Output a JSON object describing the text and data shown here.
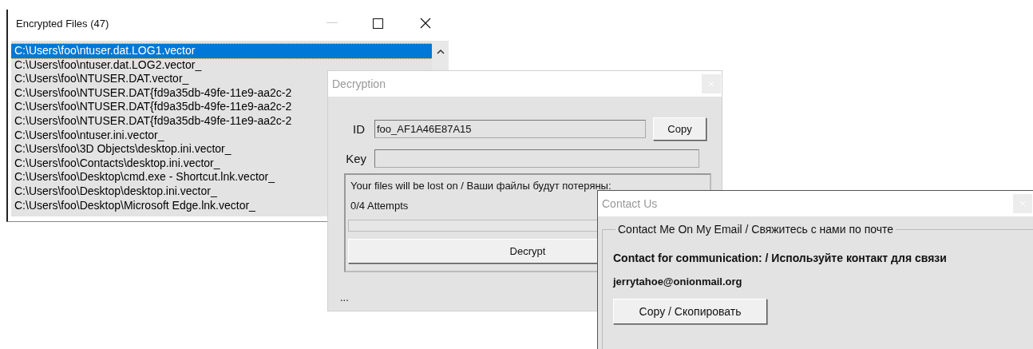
{
  "files_window": {
    "title": "Encrypted Files (47)",
    "files": [
      {
        "path": "C:\\Users\\foo\\ntuser.dat.LOG1.vector",
        "selected": true
      },
      {
        "path": "C:\\Users\\foo\\ntuser.dat.LOG2.vector_",
        "selected": false
      },
      {
        "path": "C:\\Users\\foo\\NTUSER.DAT.vector_",
        "selected": false
      },
      {
        "path": "C:\\Users\\foo\\NTUSER.DAT{fd9a35db-49fe-11e9-aa2c-2",
        "selected": false
      },
      {
        "path": "C:\\Users\\foo\\NTUSER.DAT{fd9a35db-49fe-11e9-aa2c-2",
        "selected": false
      },
      {
        "path": "C:\\Users\\foo\\NTUSER.DAT{fd9a35db-49fe-11e9-aa2c-2",
        "selected": false
      },
      {
        "path": "C:\\Users\\foo\\ntuser.ini.vector_",
        "selected": false
      },
      {
        "path": "C:\\Users\\foo\\3D Objects\\desktop.ini.vector_",
        "selected": false
      },
      {
        "path": "C:\\Users\\foo\\Contacts\\desktop.ini.vector_",
        "selected": false
      },
      {
        "path": "C:\\Users\\foo\\Desktop\\cmd.exe - Shortcut.lnk.vector_",
        "selected": false
      },
      {
        "path": "C:\\Users\\foo\\Desktop\\desktop.ini.vector_",
        "selected": false
      },
      {
        "path": "C:\\Users\\foo\\Desktop\\Microsoft Edge.lnk.vector_",
        "selected": false
      }
    ]
  },
  "decryption_window": {
    "title": "Decryption",
    "id_label": "ID",
    "id_value": "foo_AF1A46E87A15",
    "copy_button": "Copy",
    "key_label": "Key",
    "notice": "Your files will be lost on  / Ваши файлы будут потеряны:",
    "attempts": "0/4 Attempts",
    "progress": {
      "level": 0
    },
    "decrypt_button": "Decrypt",
    "status": "..."
  },
  "contact_window": {
    "title": "Contact Us",
    "group_title": "Contact Me On My Email / Свяжитесь с нами по почте",
    "label": "Contact for communication: /  Используйте контакт для связи",
    "email": "jerrytahoe@onionmail.org",
    "copy_button": "Copy / Скопировать"
  }
}
